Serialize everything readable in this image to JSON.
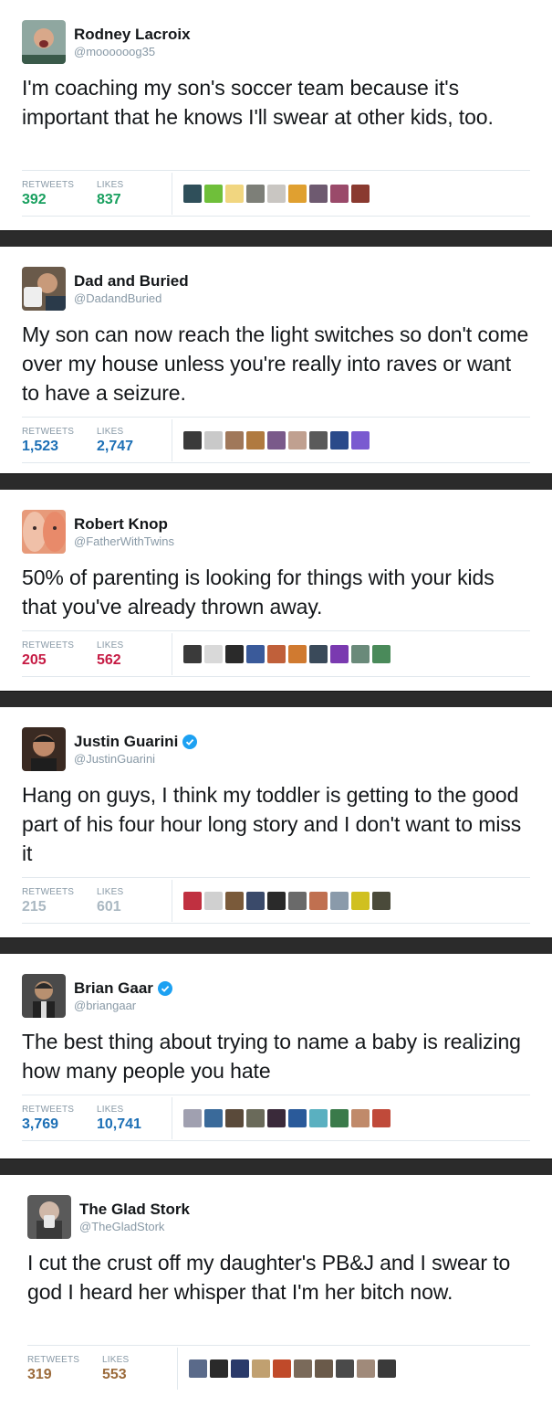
{
  "labels": {
    "retweets": "RETWEETS",
    "likes": "LIKES"
  },
  "tweets": [
    {
      "name": "Rodney Lacroix",
      "handle": "@moooooog35",
      "verified": false,
      "text": "I'm coaching my son's soccer team because it's important that he knows I'll swear at other kids, too.",
      "retweets": "392",
      "likes": "837",
      "count_color": "#19a05f",
      "avatar_bg": "#8fa7a0",
      "faces": [
        "#2f4f5a",
        "#6fbf3a",
        "#f1d680",
        "#7d7f78",
        "#c9c6c2",
        "#e0a030",
        "#6e5a70",
        "#9a4a6a",
        "#8a3a30"
      ]
    },
    {
      "name": "Dad and Buried",
      "handle": "@DadandBuried",
      "verified": false,
      "text": "My son can now reach the light switches so don't come over my house unless you're really into raves or want to have a seizure.",
      "retweets": "1,523",
      "likes": "2,747",
      "count_color": "#1c6fb5",
      "avatar_bg": "#6a5a4a",
      "faces": [
        "#3a3a3a",
        "#c9c9c9",
        "#a0785a",
        "#b07a40",
        "#7a5a8a",
        "#c0a090",
        "#5a5a5a",
        "#2a4a8a",
        "#7a5ad0"
      ]
    },
    {
      "name": "Robert Knop",
      "handle": "@FatherWithTwins",
      "verified": false,
      "text": "50% of parenting is looking for things with your kids that you've already thrown away.",
      "retweets": "205",
      "likes": "562",
      "count_color": "#c61b44",
      "avatar_bg": "#e79a7a",
      "faces": [
        "#3a3a3a",
        "#d9d9d9",
        "#2a2a2a",
        "#3a5a9a",
        "#c0603a",
        "#d07a30",
        "#3a4a5a",
        "#7a3ab0",
        "#6a8a7a",
        "#4a8a5a"
      ]
    },
    {
      "name": "Justin Guarini",
      "handle": "@JustinGuarini",
      "verified": true,
      "text": "Hang on guys, I think my toddler is getting to the good part of his four hour long story and I don't want to miss it",
      "retweets": "215",
      "likes": "601",
      "count_color": "#aab8c2",
      "avatar_bg": "#3a2a22",
      "faces": [
        "#c03040",
        "#d0d0d0",
        "#7a5a3a",
        "#3a4a6a",
        "#2a2a2a",
        "#6a6a6a",
        "#c07050",
        "#8a9aaa",
        "#d0c020",
        "#4a4a3a"
      ]
    },
    {
      "name": "Brian Gaar",
      "handle": "@briangaar",
      "verified": true,
      "text": "The best thing about trying to name a baby is realizing how many people you hate",
      "retweets": "3,769",
      "likes": "10,741",
      "count_color": "#1c6fb5",
      "avatar_bg": "#4a4a4a",
      "faces": [
        "#a0a0b0",
        "#3a6a9a",
        "#5a4a3a",
        "#6a6a5a",
        "#3a2a3a",
        "#2a5a9a",
        "#5ab0c0",
        "#3a7a4a",
        "#c08a6a",
        "#c04a3a"
      ]
    },
    {
      "name": "The Glad Stork",
      "handle": "@TheGladStork",
      "verified": false,
      "text": "I cut the crust off my daughter's PB&J and I swear to god I heard her whisper that I'm her bitch now.",
      "retweets": "319",
      "likes": "553",
      "count_color": "#9b6a3a",
      "avatar_bg": "#5a5a5a",
      "faces": [
        "#5a6a8a",
        "#2a2a2a",
        "#2a3a6a",
        "#c0a070",
        "#c04a2a",
        "#7a6a5a",
        "#6a5a4a",
        "#4a4a4a",
        "#a08a7a",
        "#3a3a3a"
      ]
    }
  ]
}
